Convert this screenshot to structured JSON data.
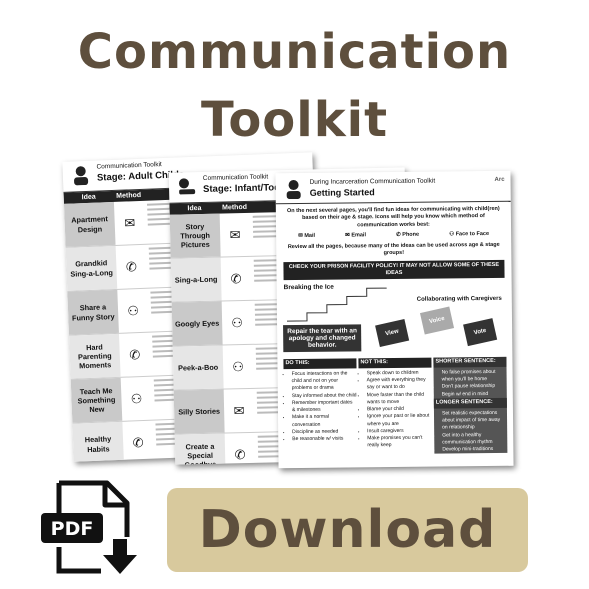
{
  "title_line1": "Communication",
  "title_line2": "Toolkit",
  "download_label": "Download",
  "pdf_label": "PDF",
  "colors": {
    "title": "#5e4f3d",
    "button_bg": "#d8c99d"
  },
  "sheet_adult": {
    "toolkit": "Communication Toolkit",
    "stage": "Stage: Adult Childr",
    "col_idea": "Idea",
    "col_method": "Method",
    "rows": [
      "Apartment Design",
      "Grandkid Sing-a-Long",
      "Share a Funny Story",
      "Hard Parenting Moments",
      "Teach Me Something New",
      "Healthy Habits"
    ]
  },
  "sheet_infant": {
    "toolkit": "Communication Toolkit",
    "stage": "Stage: Infant/Todd",
    "col_idea": "Idea",
    "col_method": "Method",
    "rows": [
      "Story Through Pictures",
      "Sing-a-Long",
      "Googly Eyes",
      "Peek-a-Boo",
      "Silly Stories",
      "Create a Special Goodbye"
    ]
  },
  "sheet_start": {
    "toolkit": "During Incarceration Communication Toolkit",
    "heading": "Getting Started",
    "logo": "Arc",
    "intro": "On the next several pages, you'll find fun ideas for communicating with child(ren) based on their age & stage. Icons will help you know which method of communication works best:",
    "methods": [
      "Mail",
      "Email",
      "Phone",
      "Face to Face"
    ],
    "review": "Review all the pages, because many of the ideas can be used across age & stage groups!",
    "banner": "CHECK YOUR PRISON FACILITY POLICY! IT MAY NOT ALLOW SOME OF THESE IDEAS",
    "breaking": "Breaking the Ice",
    "collab": "Collaborating with Caregivers",
    "repair": "Repair the tear with an apology and changed behavior.",
    "puzzle": [
      "View",
      "Voice",
      "Vote"
    ],
    "do_title": "DO THIS:",
    "do_items": [
      "Focus interactions on the child and not on your problems or drama",
      "Stay informed about the child",
      "Remember important dates & milestones",
      "Make it a normal conversation",
      "Discipline as needed",
      "Be reasonable w/ visits"
    ],
    "not_title": "NOT THIS:",
    "not_items": [
      "Speak down to children",
      "Agree with everything they say or want to do",
      "Move faster than the child wants to move",
      "Blame your child",
      "Ignore your past or lie about where you are",
      "Insult caregivers",
      "Make promises you can't really keep"
    ],
    "short_title": "SHORTER SENTENCE:",
    "short_items": [
      "No false promises about when you'll be home",
      "Don't pause relationship",
      "Begin w/ end in mind"
    ],
    "long_title": "LONGER SENTENCE:",
    "long_items": [
      "Set realistic expectations about impact of time away on relationship",
      "Get into a healthy communication rhythm",
      "Develop mini-traditions"
    ]
  }
}
